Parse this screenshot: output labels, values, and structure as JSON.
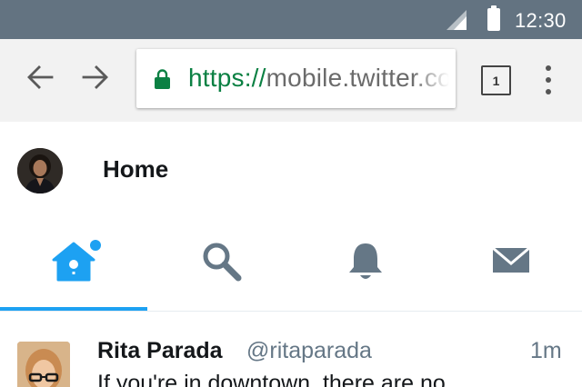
{
  "status_bar": {
    "time": "12:30",
    "icons": [
      "signal-icon",
      "battery-icon"
    ],
    "background": "#637381"
  },
  "browser": {
    "url_scheme": "https://",
    "url_rest": "mobile.twitter.co",
    "tab_count": "1",
    "icons": [
      "back-arrow-icon",
      "forward-arrow-icon",
      "lock-icon",
      "tabs-icon",
      "overflow-menu-icon"
    ],
    "toolbar_color": "#f2f2f2",
    "secure_color": "#0b8043"
  },
  "header": {
    "title": "Home"
  },
  "tabs": [
    {
      "name": "home",
      "icon": "birdhouse-icon",
      "active": true,
      "has_dot": true
    },
    {
      "name": "search",
      "icon": "search-icon",
      "active": false
    },
    {
      "name": "notifications",
      "icon": "bell-icon",
      "active": false
    },
    {
      "name": "messages",
      "icon": "envelope-icon",
      "active": false
    }
  ],
  "accent_color": "#1da1f2",
  "tweet": {
    "name": "Rita Parada",
    "handle": "@ritaparada",
    "time": "1m",
    "text": "If you're in downtown, there are no"
  }
}
